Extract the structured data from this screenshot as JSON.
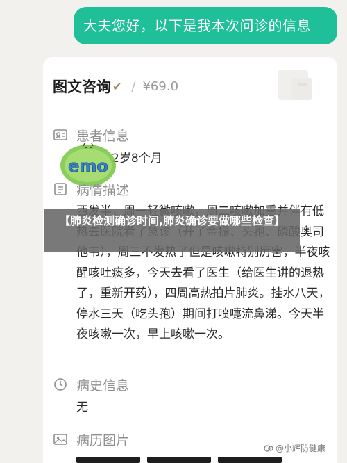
{
  "chat": {
    "message": "大夫您好，以下是我本次问诊的信息"
  },
  "consult": {
    "title": "图文咨询",
    "check_mark": "✔",
    "separator": "/",
    "price": "¥69.0"
  },
  "patient_info": {
    "label": "患者信息",
    "value": "，女，2岁8个月"
  },
  "condition": {
    "label": "病情描述",
    "description": "西发半，周一轻微咳嗽，周二咳嗽加重并伴有低热去医院看了急诊（开了金振、头孢、磷酸奥司他韦），周三不发热了但是咳嗽特别厉害，半夜咳醒咳吐痰多，今天去看了医生（给医生讲的退热了，重新开药），四周高热拍片肺炎。挂水八天，停水三天（吃头孢）期间打喷嚏流鼻涕。今天半夜咳嗽一次，早上咳嗽一次。"
  },
  "history": {
    "label": "病史信息",
    "value": "无"
  },
  "images": {
    "label": "病历图片"
  },
  "overlay": {
    "emo_text": "emo",
    "banner": "【肺炎检测确诊时间,肺炎确诊要做哪些检查】"
  },
  "watermark": {
    "text": "@小辉防健康"
  },
  "colors": {
    "accent": "#1fbf9a",
    "banner_bg": "#666666"
  },
  "icons": [
    "patient-card-icon",
    "condition-note-icon",
    "history-clock-icon",
    "gallery-image-icon",
    "emo-sticker"
  ]
}
